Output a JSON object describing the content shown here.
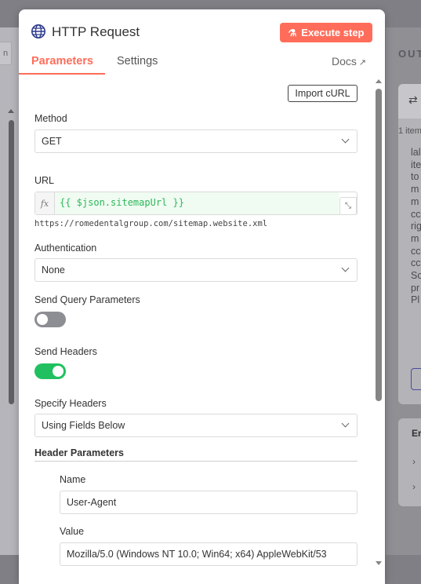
{
  "background": {
    "output_title": "OUT",
    "items_count": "1 item",
    "output_snippet": "lal\nite\nto\nm\nm\ncc\nrig\nm\ncc\ncc\nSo\npr\nPl",
    "card2_title": "Er",
    "left_peek": "n"
  },
  "modal": {
    "title": "HTTP Request",
    "icon": "globe-icon",
    "execute_label": "Execute step",
    "tabs": [
      {
        "label": "Parameters",
        "active": true
      },
      {
        "label": "Settings",
        "active": false
      }
    ],
    "docs_label": "Docs"
  },
  "params": {
    "import_curl_label": "Import cURL",
    "method": {
      "label": "Method",
      "value": "GET"
    },
    "url": {
      "label": "URL",
      "fx": "fx",
      "expression": "{{ $json.sitemapUrl }}",
      "preview": "https://romedentalgroup.com/sitemap.website.xml"
    },
    "authentication": {
      "label": "Authentication",
      "value": "None"
    },
    "send_query": {
      "label": "Send Query Parameters",
      "enabled": false
    },
    "send_headers": {
      "label": "Send Headers",
      "enabled": true
    },
    "specify_headers": {
      "label": "Specify Headers",
      "value": "Using Fields Below"
    },
    "header_parameters": {
      "label": "Header Parameters",
      "name_label": "Name",
      "name_value": "User-Agent",
      "value_label": "Value",
      "value_value": "Mozilla/5.0 (Windows NT 10.0; Win64; x64) AppleWebKit/53"
    }
  },
  "colors": {
    "accent": "#ff6d5a",
    "toggle_on": "#20c060",
    "toggle_off": "#8d8d94",
    "expression_text": "#2db85a"
  }
}
